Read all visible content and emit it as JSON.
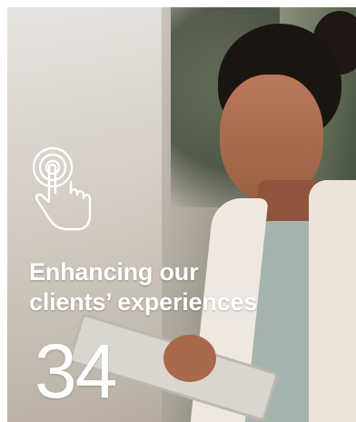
{
  "feature_card": {
    "headline_line1": "Enhancing our",
    "headline_line2": "clients’ experiences",
    "page_number": "34",
    "icon": "touch-tap-icon",
    "text_color": "#ffffff"
  }
}
